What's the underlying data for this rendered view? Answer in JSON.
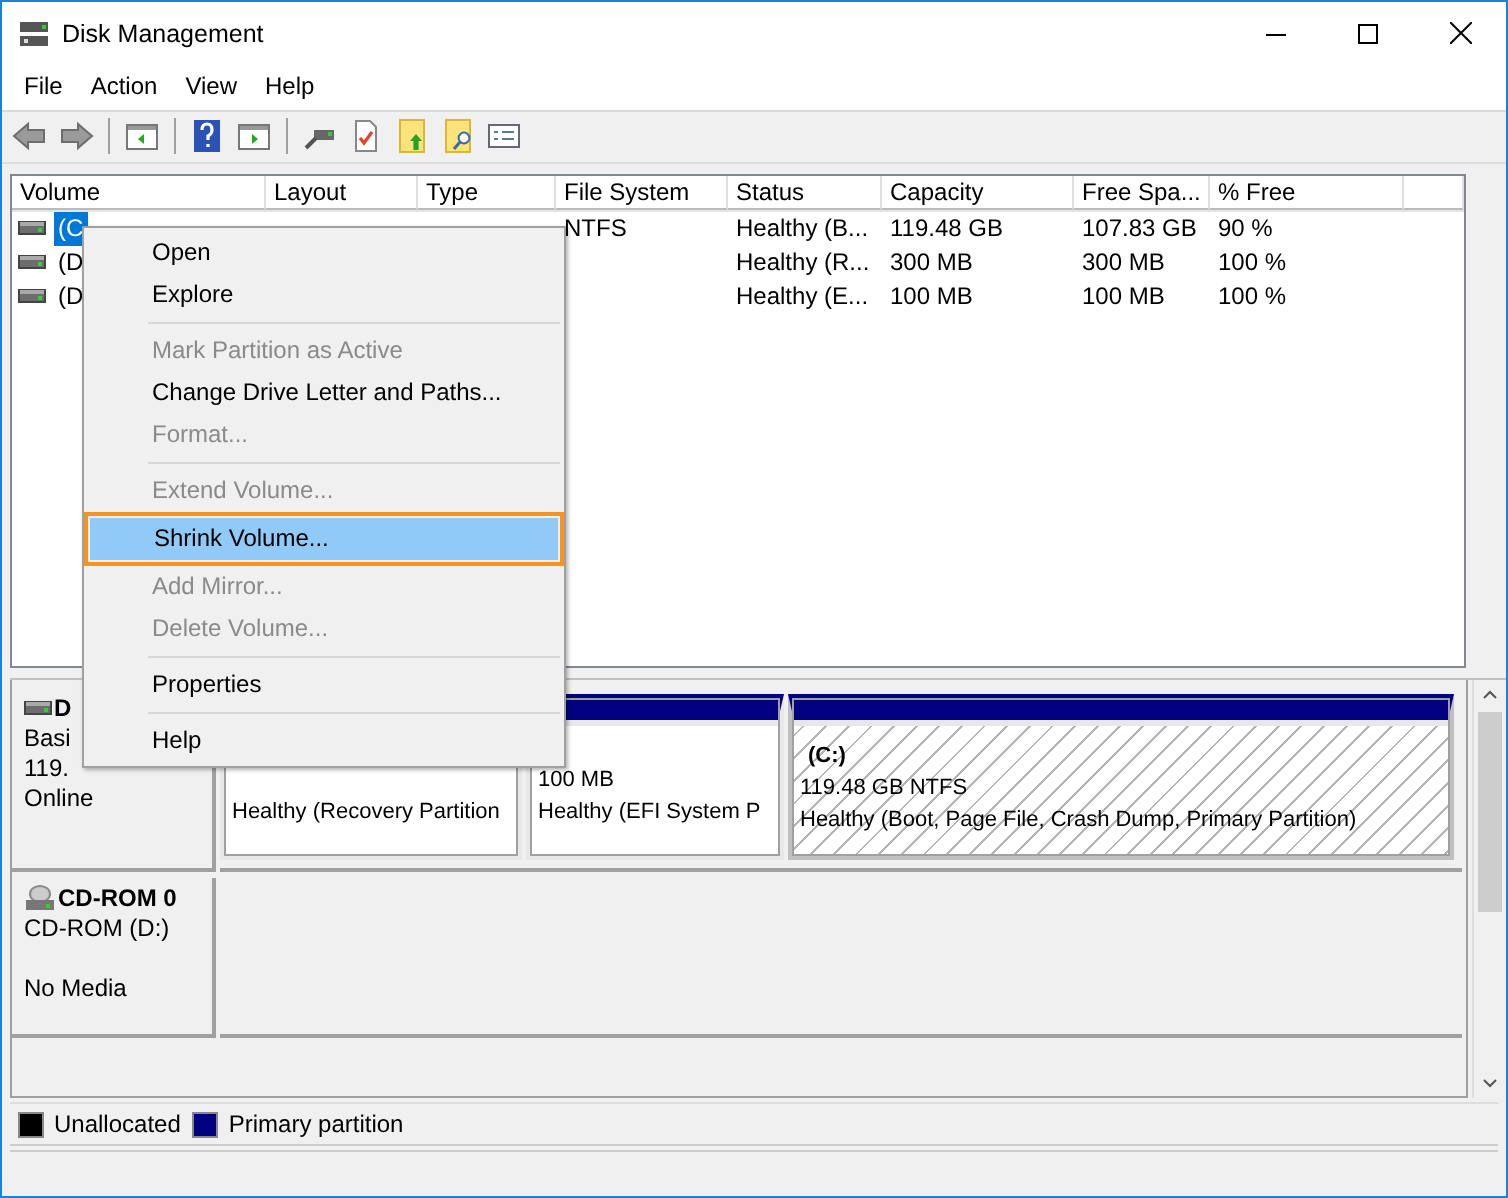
{
  "window": {
    "title": "Disk Management"
  },
  "menu_bar": [
    "File",
    "Action",
    "View",
    "Help"
  ],
  "volume_table": {
    "columns": [
      "Volume",
      "Layout",
      "Type",
      "File System",
      "Status",
      "Capacity",
      "Free Spa...",
      "% Free"
    ],
    "rows": [
      {
        "volume": "(C",
        "file_system": "NTFS",
        "status": "Healthy (B...",
        "capacity": "119.48 GB",
        "free_space": "107.83 GB",
        "percent_free": "90 %",
        "selected": true
      },
      {
        "volume": "(D",
        "status": "Healthy (R...",
        "capacity": "300 MB",
        "free_space": "300 MB",
        "percent_free": "100 %",
        "selected": false
      },
      {
        "volume": "(D",
        "status": "Healthy (E...",
        "capacity": "100 MB",
        "free_space": "100 MB",
        "percent_free": "100 %",
        "selected": false
      }
    ]
  },
  "disks": [
    {
      "kind": "disk",
      "name": "D",
      "type": "Basi",
      "size": "119.",
      "status": "Online",
      "partitions": [
        {
          "status": "Healthy (Recovery Partition",
          "selected": false
        },
        {
          "size": "100 MB",
          "status": "Healthy (EFI System P",
          "selected": false
        },
        {
          "label": "(C:)",
          "size": "119.48 GB NTFS",
          "status": "Healthy (Boot, Page File, Crash Dump, Primary Partition)",
          "selected": true
        }
      ]
    },
    {
      "kind": "cdrom",
      "name": "CD-ROM 0",
      "type": "CD-ROM (D:)",
      "status": "No Media"
    }
  ],
  "legend": [
    {
      "label": "Unallocated",
      "color": "#000000"
    },
    {
      "label": "Primary partition",
      "color": "#000080"
    }
  ],
  "context_menu": [
    {
      "kind": "item",
      "label": "Open",
      "disabled": false,
      "selected": false
    },
    {
      "kind": "item",
      "label": "Explore",
      "disabled": false,
      "selected": false
    },
    {
      "kind": "separator"
    },
    {
      "kind": "item",
      "label": "Mark Partition as Active",
      "disabled": true,
      "selected": false
    },
    {
      "kind": "item",
      "label": "Change Drive Letter and Paths...",
      "disabled": false,
      "selected": false
    },
    {
      "kind": "item",
      "label": "Format...",
      "disabled": true,
      "selected": false
    },
    {
      "kind": "separator"
    },
    {
      "kind": "item",
      "label": "Extend Volume...",
      "disabled": true,
      "selected": false
    },
    {
      "kind": "item",
      "label": "Shrink Volume...",
      "disabled": false,
      "selected": true
    },
    {
      "kind": "item",
      "label": "Add Mirror...",
      "disabled": true,
      "selected": false
    },
    {
      "kind": "item",
      "label": "Delete Volume...",
      "disabled": true,
      "selected": false
    },
    {
      "kind": "separator"
    },
    {
      "kind": "item",
      "label": "Properties",
      "disabled": false,
      "selected": false
    },
    {
      "kind": "separator"
    },
    {
      "kind": "item",
      "label": "Help",
      "disabled": false,
      "selected": false
    }
  ]
}
